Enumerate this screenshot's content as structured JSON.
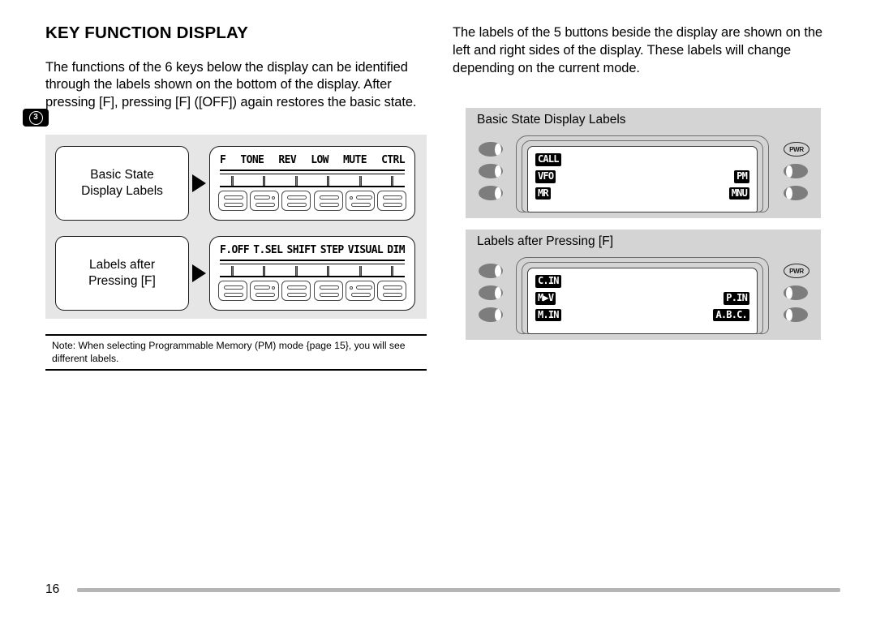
{
  "page": {
    "chapter_marker": "3",
    "page_number": "16",
    "section_title": "KEY FUNCTION DISPLAY"
  },
  "left_column": {
    "intro_paragraph": "The functions of the 6 keys below the display can be identified through the labels shown on the bottom of the display.   After pressing [F], pressing [F] ([OFF]) again restores the basic state.",
    "note": "Note:  When selecting Programmable Memory (PM) mode {page 15}, you will see different labels."
  },
  "right_column": {
    "intro_paragraph": "The labels of the 5 buttons beside the display are shown on the left and right sides of the display.  These labels will change depending on the current mode."
  },
  "key_figure": {
    "rows": [
      {
        "callout": "Basic State\nDisplay Labels",
        "callout_line1": "Basic State",
        "callout_line2": "Display Labels",
        "key_labels": [
          "F",
          "TONE",
          "REV",
          "LOW",
          "MUTE",
          "CTRL"
        ]
      },
      {
        "callout": "Labels after\nPressing [F]",
        "callout_line1": "Labels after",
        "callout_line2": "Pressing [F]",
        "key_labels": [
          "F.OFF",
          "T.SEL",
          "SHIFT",
          "STEP",
          "VISUAL",
          "DIM"
        ]
      }
    ],
    "arrow_icon": "right-triangle-arrow"
  },
  "radio_panels": [
    {
      "caption": "Basic State Display Labels",
      "left_labels": [
        "CALL",
        "VFO",
        "MR"
      ],
      "right_labels": [
        "",
        "PM",
        "MNU"
      ],
      "power_button_label": "PWR"
    },
    {
      "caption": "Labels after Pressing [F]",
      "left_labels": [
        "C.IN",
        "M▶V",
        "M.IN"
      ],
      "right_labels": [
        "",
        "P.IN",
        "A.B.C."
      ],
      "power_button_label": "PWR"
    }
  ],
  "colors": {
    "figure_bg": "#e6e6e6",
    "panel_bg": "#d4d4d4",
    "button_gray": "#7d7d7d",
    "footer_rule": "#b5b5b5",
    "text": "#000000"
  }
}
